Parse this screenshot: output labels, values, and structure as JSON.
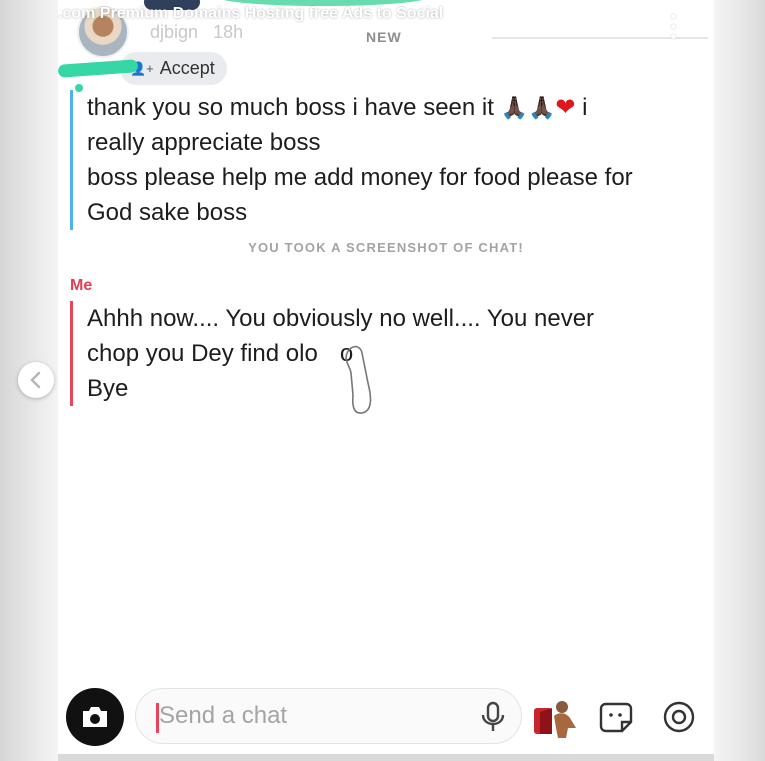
{
  "watermark": ".com Premium Domains Hosting free Ads to Social",
  "story": {
    "username": "djbign",
    "time_ago": "18h",
    "new_label": "NEW",
    "accept_label": "Accept"
  },
  "chat": {
    "friend_message": {
      "lines": [
        "thank you so much boss i have seen it",
        "i",
        "really appreciate boss",
        "boss please help me add money for food please for",
        "God sake boss"
      ],
      "emojis": [
        "🙏🏿🙏🏿",
        "❤"
      ]
    },
    "screenshot_notice": "YOU TOOK A SCREENSHOT OF CHAT!",
    "me_label": "Me",
    "my_message": {
      "lines": [
        "Ahhh now.... You obviously no well.... You never",
        "chop you Dey find olo",
        "o",
        "Bye"
      ]
    }
  },
  "composer": {
    "placeholder": "Send a chat"
  },
  "icons": {
    "camera": "camera-icon",
    "mic": "microphone-icon",
    "bitmoji": "bitmoji-icon",
    "sticker": "sticker-icon",
    "games": "games-icon",
    "more": "more-vertical-icon",
    "prev": "chevron-left-icon",
    "add_friend": "add-friend-icon"
  },
  "colors": {
    "friend_bar": "#4db4e8",
    "me_bar": "#e8455b",
    "accent_green": "#37d6a6"
  }
}
